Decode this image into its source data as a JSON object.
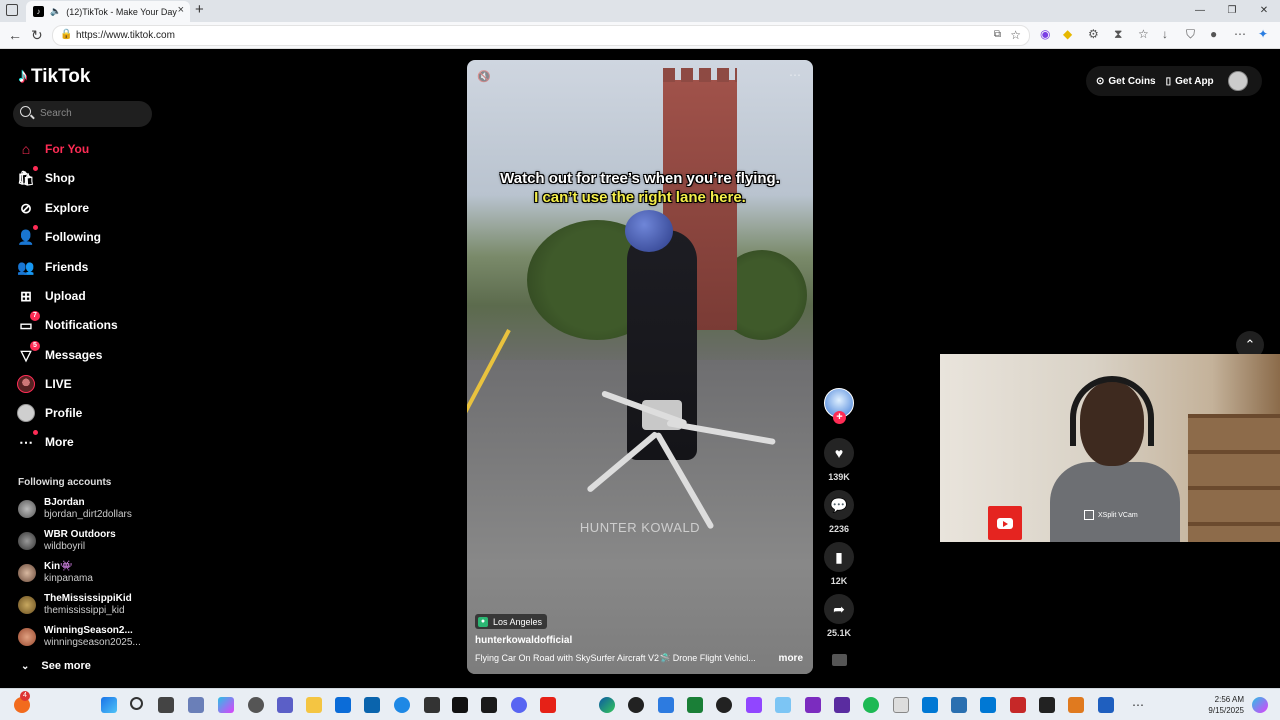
{
  "browser": {
    "tab_title": "(12)TikTok - Make Your Day",
    "url": "https://www.tiktok.com",
    "new_tab": "+",
    "close_tab": "×"
  },
  "sidebar": {
    "brand": "TikTok",
    "search_placeholder": "Search",
    "nav": [
      {
        "label": "For You",
        "icon": "home-icon",
        "active": true
      },
      {
        "label": "Shop",
        "icon": "shop-icon"
      },
      {
        "label": "Explore",
        "icon": "compass-icon"
      },
      {
        "label": "Following",
        "icon": "following-icon"
      },
      {
        "label": "Friends",
        "icon": "friends-icon"
      },
      {
        "label": "Upload",
        "icon": "upload-icon"
      },
      {
        "label": "Notifications",
        "icon": "inbox-icon",
        "badge": "7"
      },
      {
        "label": "Messages",
        "icon": "send-icon",
        "badge": "5"
      },
      {
        "label": "LIVE",
        "icon": "live-icon"
      },
      {
        "label": "Profile",
        "icon": "profile-icon"
      },
      {
        "label": "More",
        "icon": "more-icon"
      }
    ],
    "following_title": "Following accounts",
    "accounts": [
      {
        "display": "BJordan",
        "user": "bjordan_dirt2dollars"
      },
      {
        "display": "WBR Outdoors",
        "user": "wildboyril"
      },
      {
        "display": "Kin👾",
        "user": "kinpanama"
      },
      {
        "display": "TheMississippiKid",
        "user": "themississippi_kid"
      },
      {
        "display": "WinningSeason2...",
        "user": "winningseason2025..."
      }
    ],
    "see_more": "See more"
  },
  "video": {
    "caption_line1": "Watch out for tree’s when you’re flying.",
    "caption_line2": "I can’t use the right lane here.",
    "watermark": "HUNTER KOWALD",
    "location": "Los Angeles",
    "author": "hunterkowaldofficial",
    "description": "Flying Car On Road with SkySurfer Aircraft V2🛸 Drone Flight Vehicl...",
    "more": "more"
  },
  "actions": {
    "likes": "139K",
    "comments": "2236",
    "saves": "12K",
    "shares": "25.1K"
  },
  "topright": {
    "get_coins": "Get Coins",
    "get_app": "Get App"
  },
  "webcam": {
    "xsplit_label": "XSplit VCam"
  },
  "taskbar": {
    "time": "2:56 AM",
    "date": "9/15/2025",
    "notif_count": "4"
  }
}
